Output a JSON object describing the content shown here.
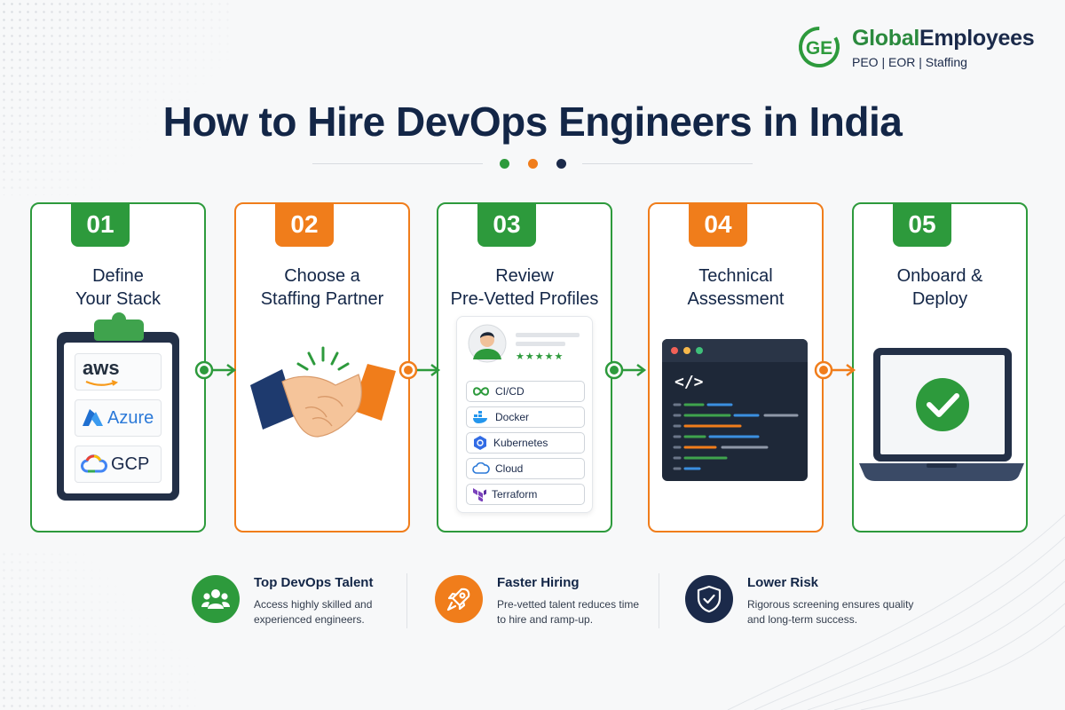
{
  "brand": {
    "mark": "GE",
    "name_part1": "Global",
    "name_part2": "Employees",
    "tagline": "PEO  |  EOR  |  Staffing",
    "colors": {
      "green": "#2d9a3c",
      "navy": "#1b2a4a",
      "orange": "#f07d1b"
    }
  },
  "title": "How to Hire DevOps Engineers in India",
  "steps": [
    {
      "number": "01",
      "title_line1": "Define",
      "title_line2": "Your Stack",
      "accent": "green",
      "clouds": [
        "aws",
        "Azure",
        "GCP"
      ]
    },
    {
      "number": "02",
      "title_line1": "Choose a",
      "title_line2": "Staffing Partner",
      "accent": "orange"
    },
    {
      "number": "03",
      "title_line1": "Review",
      "title_line2": "Pre-Vetted Profiles",
      "accent": "green",
      "skills": [
        "CI/CD",
        "Docker",
        "Kubernetes",
        "Cloud",
        "Terraform"
      ],
      "rating": "★★★★★"
    },
    {
      "number": "04",
      "title_line1": "Technical",
      "title_line2": "Assessment",
      "accent": "orange",
      "code_symbol": "</>"
    },
    {
      "number": "05",
      "title_line1": "Onboard &",
      "title_line2": "Deploy",
      "accent": "green"
    }
  ],
  "benefits": [
    {
      "title": "Top DevOps Talent",
      "description": "Access highly skilled and experienced engineers.",
      "icon": "people-icon",
      "color": "#2d9a3c"
    },
    {
      "title": "Faster Hiring",
      "description": "Pre-vetted talent reduces time to hire and ramp-up.",
      "icon": "rocket-icon",
      "color": "#f07d1b"
    },
    {
      "title": "Lower Risk",
      "description": "Rigorous screening ensures quality and long-term success.",
      "icon": "shield-check-icon",
      "color": "#1b2a4a"
    }
  ]
}
